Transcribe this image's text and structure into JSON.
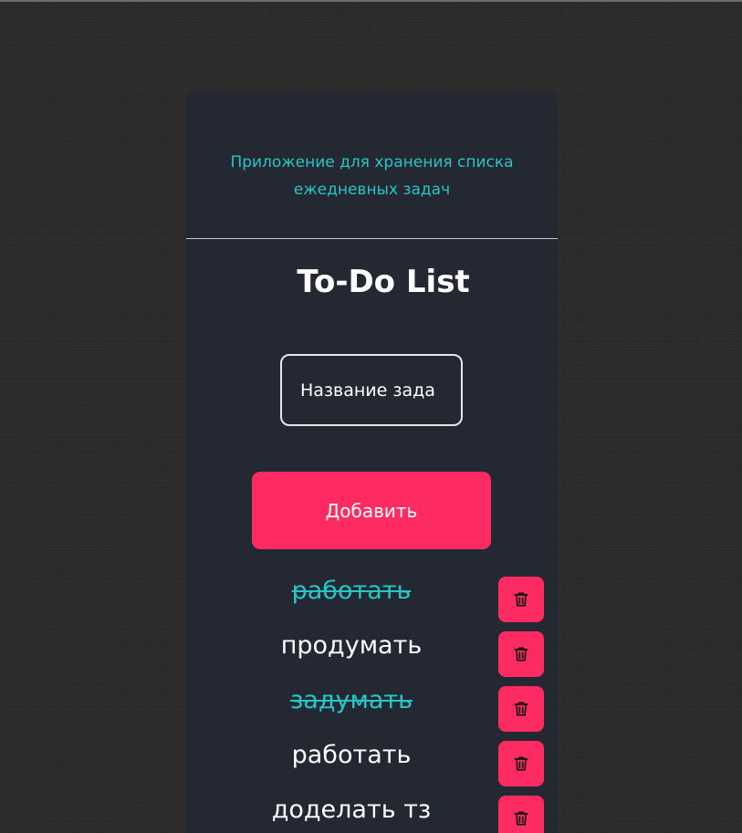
{
  "app": {
    "subtitle_line1": "Приложение для хранения списка",
    "subtitle_line2": "ежедневных задач",
    "title": "To-Do List"
  },
  "form": {
    "input_value": "Название зада",
    "add_button_label": "Добавить"
  },
  "tasks": [
    {
      "text": "работать",
      "done": true
    },
    {
      "text": "продумать",
      "done": false
    },
    {
      "text": "задумать",
      "done": true
    },
    {
      "text": "работать",
      "done": false
    },
    {
      "text": "доделать тз",
      "done": false
    }
  ],
  "icons": {
    "delete": "trash-icon"
  },
  "colors": {
    "page_background": "#2b2a29",
    "card_background": "#242832",
    "accent_teal": "#26c6c6",
    "accent_pink": "#fe2b62",
    "text": "#ffffff"
  }
}
